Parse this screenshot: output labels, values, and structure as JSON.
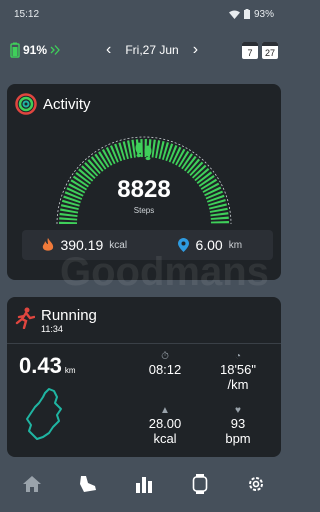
{
  "status": {
    "time": "15:12",
    "battery": "93%"
  },
  "header": {
    "watch_battery": "91%",
    "date": "Fri,27 Jun",
    "cal_day1": "7",
    "cal_day2": "27"
  },
  "activity": {
    "title": "Activity",
    "steps": "8828",
    "steps_label": "Steps",
    "calories": "390.19",
    "calories_unit": "kcal",
    "distance": "6.00",
    "distance_unit": "km"
  },
  "running": {
    "title": "Running",
    "time": "11:34",
    "distance": "0.43",
    "distance_unit": "km",
    "duration": "08:12",
    "pace": "18'56\"",
    "pace_unit": "/km",
    "calories": "28.00",
    "calories_unit": "kcal",
    "heart_rate": "93",
    "heart_rate_unit": "bpm"
  },
  "watermark": "Goodmans",
  "colors": {
    "accent_green": "#3fd05a",
    "card": "#1f2327",
    "bg": "#46505b",
    "teal": "#1fb5a2"
  }
}
